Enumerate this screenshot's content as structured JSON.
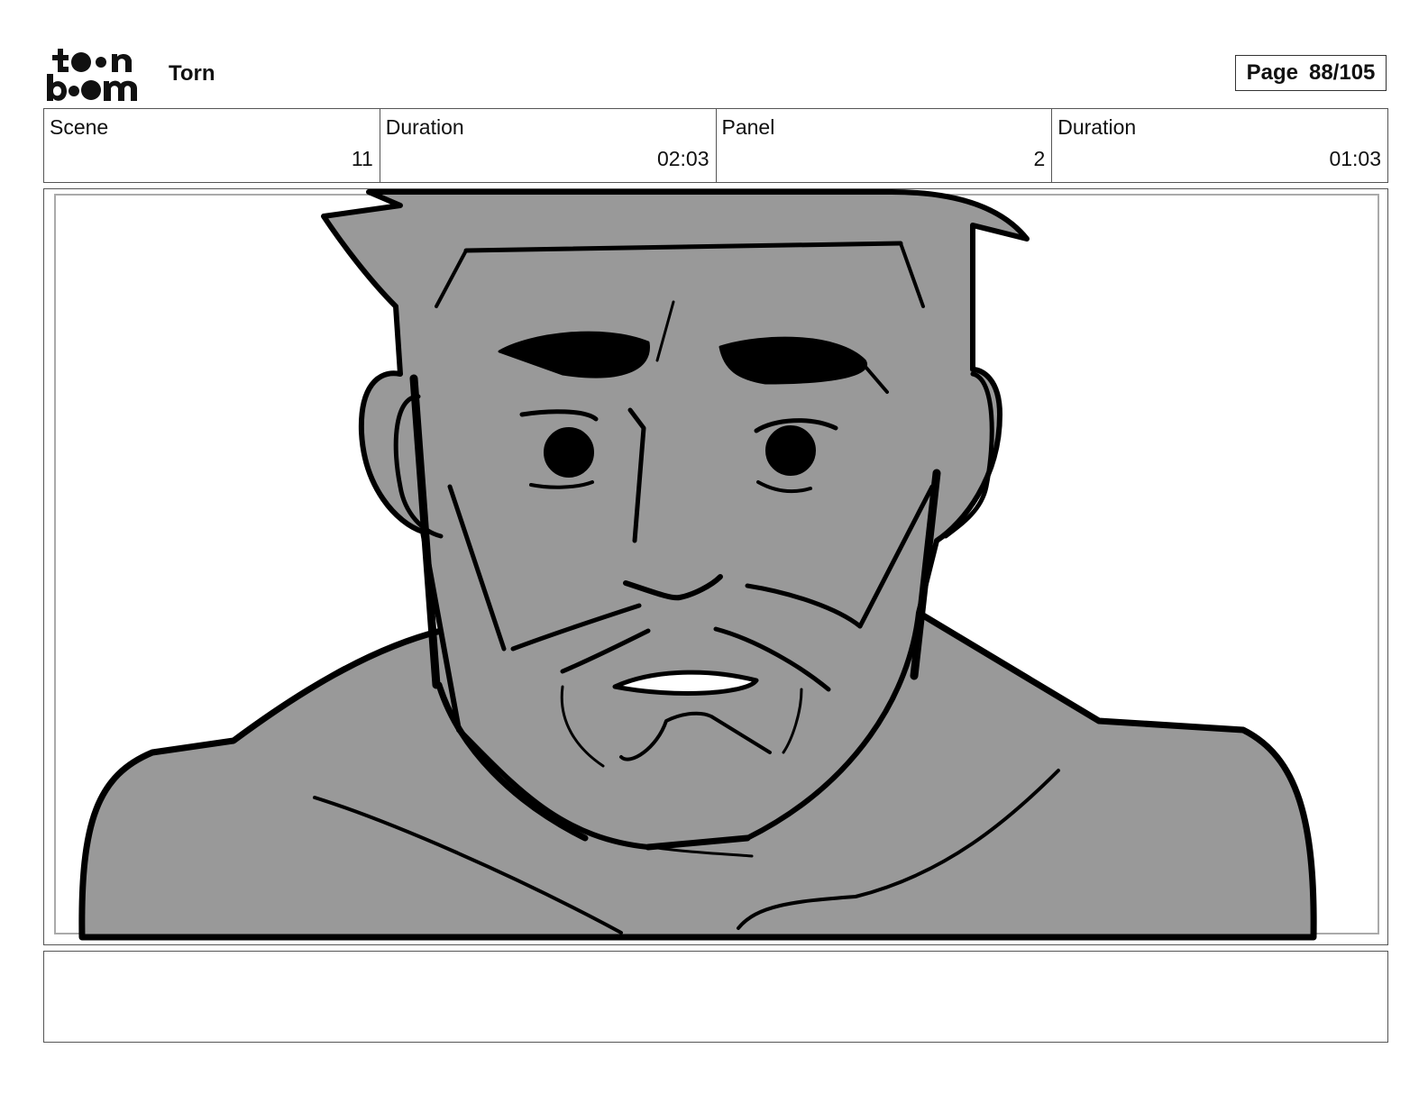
{
  "header": {
    "brand_logo": "toon boom",
    "project_title": "Torn",
    "page_label": "Page",
    "page_number": "88/105"
  },
  "info_row": [
    {
      "label": "Scene",
      "value": "11"
    },
    {
      "label": "Duration",
      "value": "02:03"
    },
    {
      "label": "Panel",
      "value": "2"
    },
    {
      "label": "Duration",
      "value": "01:03"
    }
  ],
  "colors": {
    "sketch_fill": "#999999",
    "line": "#000000"
  }
}
